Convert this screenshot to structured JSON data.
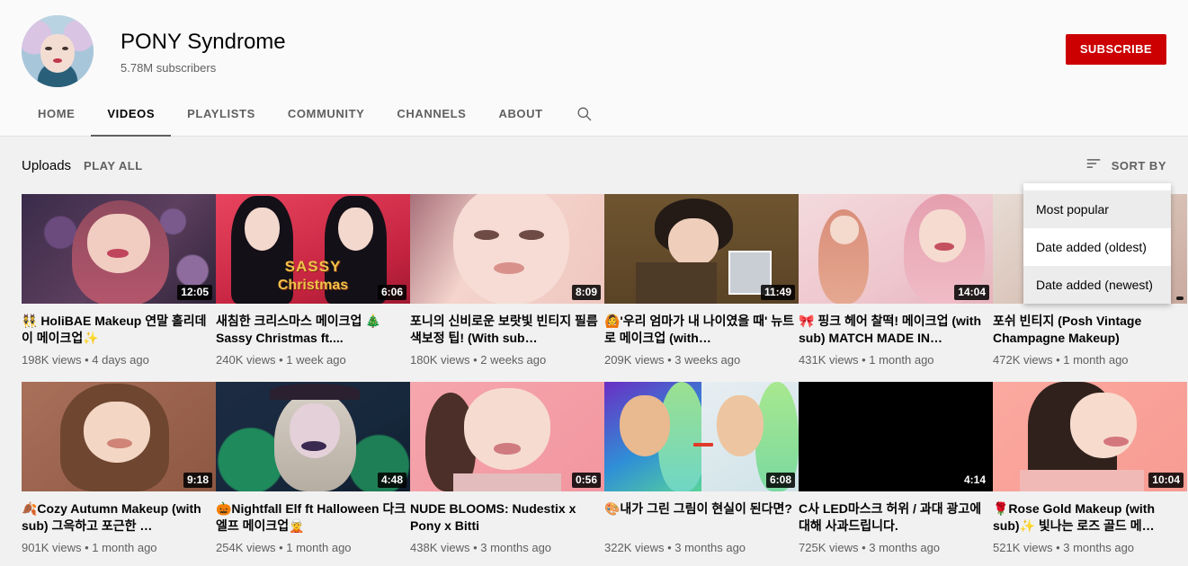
{
  "channel": {
    "name": "PONY Syndrome",
    "subscribers": "5.78M subscribers",
    "subscribe_label": "SUBSCRIBE",
    "avatar_name": "channel-avatar"
  },
  "tabs": [
    {
      "label": "HOME",
      "active": false
    },
    {
      "label": "VIDEOS",
      "active": true
    },
    {
      "label": "PLAYLISTS",
      "active": false
    },
    {
      "label": "COMMUNITY",
      "active": false
    },
    {
      "label": "CHANNELS",
      "active": false
    },
    {
      "label": "ABOUT",
      "active": false
    }
  ],
  "search_icon": "search-icon",
  "shelf": {
    "title": "Uploads",
    "play_all": "PLAY ALL",
    "sort_label": "SORT BY",
    "sort_icon": "sort-icon"
  },
  "sort_menu": {
    "open": true,
    "items": [
      {
        "label": "Most popular",
        "highlighted": true
      },
      {
        "label": "Date added (oldest)",
        "highlighted": false
      },
      {
        "label": "Date added (newest)",
        "highlighted": true
      }
    ]
  },
  "colors": {
    "brand_red": "#cc0000",
    "content_bg": "#f1f1f1",
    "header_bg": "#fafafa",
    "primary_text": "#030303",
    "secondary_text": "#606060"
  },
  "videos": [
    {
      "title": "👯 HoliBAE Makeup 연말 홀리데이 메이크업✨",
      "duration": "12:05",
      "views": "198K views",
      "age": "4 days ago",
      "meta": "198K views • 4 days ago"
    },
    {
      "title": "새침한 크리스마스 메이크업 🎄Sassy Christmas ft....",
      "duration": "6:06",
      "views": "240K views",
      "age": "1 week ago",
      "meta": "240K views • 1 week ago"
    },
    {
      "title": "포니의 신비로운 보랏빛 빈티지 필름 색보정 팁! (With sub…",
      "duration": "8:09",
      "views": "180K views",
      "age": "2 weeks ago",
      "meta": "180K views • 2 weeks ago"
    },
    {
      "title": "🙆'우리 엄마가 내 나이였을 때' 뉴트로 메이크업 (with…",
      "duration": "11:49",
      "views": "209K views",
      "age": "3 weeks ago",
      "meta": "209K views • 3 weeks ago"
    },
    {
      "title": "🎀 핑크 헤어 찰떡! 메이크업 (with sub) MATCH MADE IN…",
      "duration": "14:04",
      "views": "431K views",
      "age": "1 month ago",
      "meta": "431K views • 1 month ago"
    },
    {
      "title": "포쉬 빈티지 (Posh Vintage Champagne Makeup)",
      "duration": "",
      "views": "472K views",
      "age": "1 month ago",
      "meta": "472K views • 1 month ago"
    },
    {
      "title": "🍂Cozy Autumn Makeup (with sub) 그윽하고 포근한 …",
      "duration": "9:18",
      "views": "901K views",
      "age": "1 month ago",
      "meta": "901K views • 1 month ago"
    },
    {
      "title": "🎃Nightfall Elf ft Halloween 다크 엘프 메이크업🧝",
      "duration": "4:48",
      "views": "254K views",
      "age": "1 month ago",
      "meta": "254K views • 1 month ago"
    },
    {
      "title": "NUDE BLOOMS: Nudestix x Pony x Bitti",
      "duration": "0:56",
      "views": "438K views",
      "age": "3 months ago",
      "meta": "438K views • 3 months ago"
    },
    {
      "title": "🎨내가 그린 그림이 현실이 된다면?",
      "duration": "6:08",
      "views": "322K views",
      "age": "3 months ago",
      "meta": "322K views • 3 months ago"
    },
    {
      "title": "C사 LED마스크 허위 / 과대 광고에 대해 사과드립니다.",
      "duration": "4:14",
      "views": "725K views",
      "age": "3 months ago",
      "meta": "725K views • 3 months ago"
    },
    {
      "title": "🌹Rose Gold Makeup (with sub)✨ 빛나는 로즈 골드 메…",
      "duration": "10:04",
      "views": "521K views",
      "age": "3 months ago",
      "meta": "521K views • 3 months ago"
    }
  ]
}
